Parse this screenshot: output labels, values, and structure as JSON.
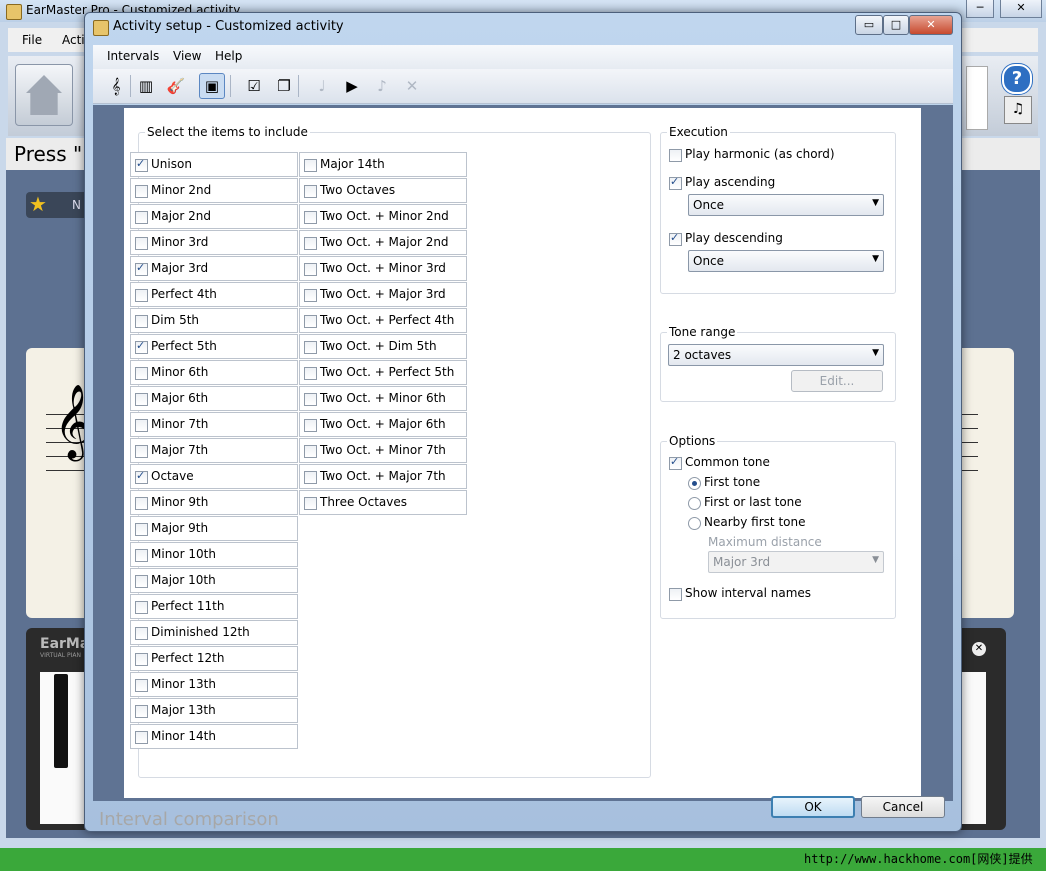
{
  "background_window": {
    "title": "EarMaster Pro - Customized activity",
    "menus": [
      "File",
      "Acti"
    ],
    "press_text": "Press \"I",
    "star_text": "N",
    "piano_logo": "EarMa",
    "piano_logo_sub": "VIRTUAL PIAN",
    "help_glyph": "?",
    "controls": {
      "minimize": "─",
      "maximize": "□",
      "close": "✕"
    }
  },
  "dialog": {
    "title": "Activity setup - Customized activity",
    "menus": [
      "Intervals",
      "View",
      "Help"
    ],
    "toolbar_icons": [
      {
        "name": "staff-icon",
        "glyph": "𝄞",
        "state": "normal"
      },
      {
        "name": "piano-icon",
        "glyph": "▥",
        "state": "normal"
      },
      {
        "name": "guitar-icon",
        "glyph": "🎸",
        "state": "normal"
      },
      {
        "name": "select-all-icon",
        "glyph": "▣",
        "state": "selected"
      },
      {
        "name": "check-list-icon",
        "glyph": "☑",
        "state": "normal"
      },
      {
        "name": "copy-icon",
        "glyph": "❐",
        "state": "normal"
      },
      {
        "name": "add-note-icon",
        "glyph": "♩",
        "state": "disabled"
      },
      {
        "name": "play-icon",
        "glyph": "▶",
        "state": "normal"
      },
      {
        "name": "settings-note-icon",
        "glyph": "♪",
        "state": "disabled"
      },
      {
        "name": "delete-note-icon",
        "glyph": "✕",
        "state": "disabled"
      }
    ],
    "window_controls": {
      "minimize": "▭",
      "maximize": "□",
      "close": "✕"
    },
    "items_group_label": "Select the items to include",
    "items_col1": [
      {
        "label": "Unison",
        "checked": true
      },
      {
        "label": "Minor 2nd",
        "checked": false
      },
      {
        "label": "Major 2nd",
        "checked": false
      },
      {
        "label": "Minor 3rd",
        "checked": false
      },
      {
        "label": "Major 3rd",
        "checked": true
      },
      {
        "label": "Perfect 4th",
        "checked": false
      },
      {
        "label": "Dim 5th",
        "checked": false
      },
      {
        "label": "Perfect 5th",
        "checked": true
      },
      {
        "label": "Minor 6th",
        "checked": false
      },
      {
        "label": "Major 6th",
        "checked": false
      },
      {
        "label": "Minor 7th",
        "checked": false
      },
      {
        "label": "Major 7th",
        "checked": false
      },
      {
        "label": "Octave",
        "checked": true
      },
      {
        "label": "Minor 9th",
        "checked": false
      },
      {
        "label": "Major 9th",
        "checked": false
      },
      {
        "label": "Minor 10th",
        "checked": false
      },
      {
        "label": "Major 10th",
        "checked": false
      },
      {
        "label": "Perfect 11th",
        "checked": false
      },
      {
        "label": "Diminished 12th",
        "checked": false
      },
      {
        "label": "Perfect 12th",
        "checked": false
      },
      {
        "label": "Minor 13th",
        "checked": false
      },
      {
        "label": "Major 13th",
        "checked": false
      },
      {
        "label": "Minor 14th",
        "checked": false
      }
    ],
    "items_col2": [
      {
        "label": "Major 14th",
        "checked": false
      },
      {
        "label": "Two Octaves",
        "checked": false
      },
      {
        "label": "Two Oct. + Minor 2nd",
        "checked": false
      },
      {
        "label": "Two Oct. + Major 2nd",
        "checked": false
      },
      {
        "label": "Two Oct. + Minor 3rd",
        "checked": false
      },
      {
        "label": "Two Oct. + Major 3rd",
        "checked": false
      },
      {
        "label": "Two Oct. + Perfect 4th",
        "checked": false
      },
      {
        "label": "Two Oct. + Dim 5th",
        "checked": false
      },
      {
        "label": "Two Oct. + Perfect 5th",
        "checked": false
      },
      {
        "label": "Two Oct. + Minor 6th",
        "checked": false
      },
      {
        "label": "Two Oct. + Major 6th",
        "checked": false
      },
      {
        "label": "Two Oct. + Minor 7th",
        "checked": false
      },
      {
        "label": "Two Oct. + Major 7th",
        "checked": false
      },
      {
        "label": "Three Octaves",
        "checked": false
      }
    ],
    "execution": {
      "label": "Execution",
      "play_harmonic": {
        "label": "Play harmonic (as chord)",
        "checked": false
      },
      "play_ascending": {
        "label": "Play ascending",
        "checked": true,
        "mode": "Once"
      },
      "play_descending": {
        "label": "Play descending",
        "checked": true,
        "mode": "Once"
      }
    },
    "tone_range": {
      "label": "Tone range",
      "value": "2 octaves",
      "edit_label": "Edit..."
    },
    "options": {
      "label": "Options",
      "common_tone": {
        "label": "Common tone",
        "checked": true
      },
      "radios": [
        {
          "label": "First tone",
          "selected": true
        },
        {
          "label": "First or last tone",
          "selected": false
        },
        {
          "label": "Nearby first tone",
          "selected": false
        }
      ],
      "max_distance_label": "Maximum distance",
      "max_distance_value": "Major 3rd",
      "show_names": {
        "label": "Show interval names",
        "checked": false
      }
    },
    "footer_label": "Interval comparison",
    "ok_label": "OK",
    "cancel_label": "Cancel"
  },
  "watermark": "http://www.hackhome.com[网侠]提供"
}
